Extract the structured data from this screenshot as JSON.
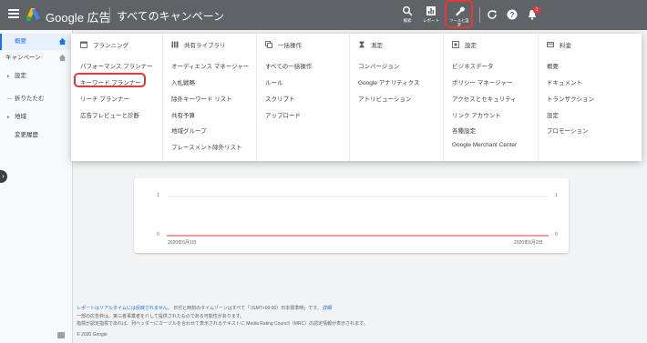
{
  "header": {
    "brand": "Google 広告",
    "campaign_title": "すべてのキャンペーン",
    "buttons": [
      {
        "name": "search",
        "label": "検索"
      },
      {
        "name": "reports",
        "label": "レポート"
      },
      {
        "name": "tools",
        "label": "ツールと設定"
      }
    ],
    "notification_count": "1",
    "colors": {
      "bar": "#5f6368",
      "highlight": "#e53935",
      "accent": "#1a73e8"
    }
  },
  "leftnav": {
    "items": [
      {
        "label": "概要",
        "active": true
      },
      {
        "label": "キャンペーン"
      },
      {
        "label": "設定",
        "expandable": true
      },
      {
        "label": "折りたたむ",
        "prefix": "—"
      },
      {
        "label": "地域",
        "expandable": true
      },
      {
        "label": "変更履歴"
      }
    ]
  },
  "menu": {
    "columns": [
      {
        "title": "プランニング",
        "icon": "calendar-icon",
        "items": [
          "パフォーマンス プランナー",
          "キーワード プランナー",
          "リーチ プランナー",
          "広告プレビューと診断"
        ]
      },
      {
        "title": "共有ライブラリ",
        "icon": "library-icon",
        "items": [
          "オーディエンス マネージャー",
          "入札戦略",
          "除外キーワード リスト",
          "共有予算",
          "地域グループ",
          "プレースメント除外リスト"
        ]
      },
      {
        "title": "一括操作",
        "icon": "copy-icon",
        "items": [
          "すべての一括操作",
          "ルール",
          "スクリプト",
          "アップロード"
        ]
      },
      {
        "title": "測定",
        "icon": "hourglass-icon",
        "items": [
          "コンバージョン",
          "Google アナリティクス",
          "アトリビューション"
        ]
      },
      {
        "title": "設定",
        "icon": "settings-box-icon",
        "items": [
          "ビジネスデータ",
          "ポリシー マネージャー",
          "アクセスとセキュリティ",
          "リンク アカウント",
          "各種設定",
          "Google Merchant Center"
        ]
      },
      {
        "title": "料金",
        "icon": "card-icon",
        "items": [
          "概要",
          "ドキュメント",
          "トランザクション",
          "設定",
          "プロモーション"
        ]
      }
    ]
  },
  "chart": {
    "y_ticks": [
      "1",
      "0"
    ],
    "x_start": "2020年6月1日",
    "x_end": "2020年6月2日"
  },
  "chart_data": {
    "type": "line",
    "x": [
      "2020年6月1日",
      "2020年6月2日"
    ],
    "series": [
      {
        "values": [
          0,
          0
        ]
      }
    ],
    "ylim": [
      0,
      1
    ]
  },
  "footer": {
    "line1_link": "レポートはリアルタイムには反映されません。",
    "line1_rest": "日付と時刻のタイムゾーンはすべて「（GMT+09:00）日本標準時」です。",
    "line1_link2": "詳細",
    "line2": "一部の広告枠は、第三者事業者を介して提供されたものである可能性があります。",
    "line3": "指標が認定指標であれば、列ヘッダーにカーソルを合わせて表示されるテキストに Media Rating Council（MRC）の認定情報が表示されます。",
    "copyright": "© 2020 Google"
  }
}
